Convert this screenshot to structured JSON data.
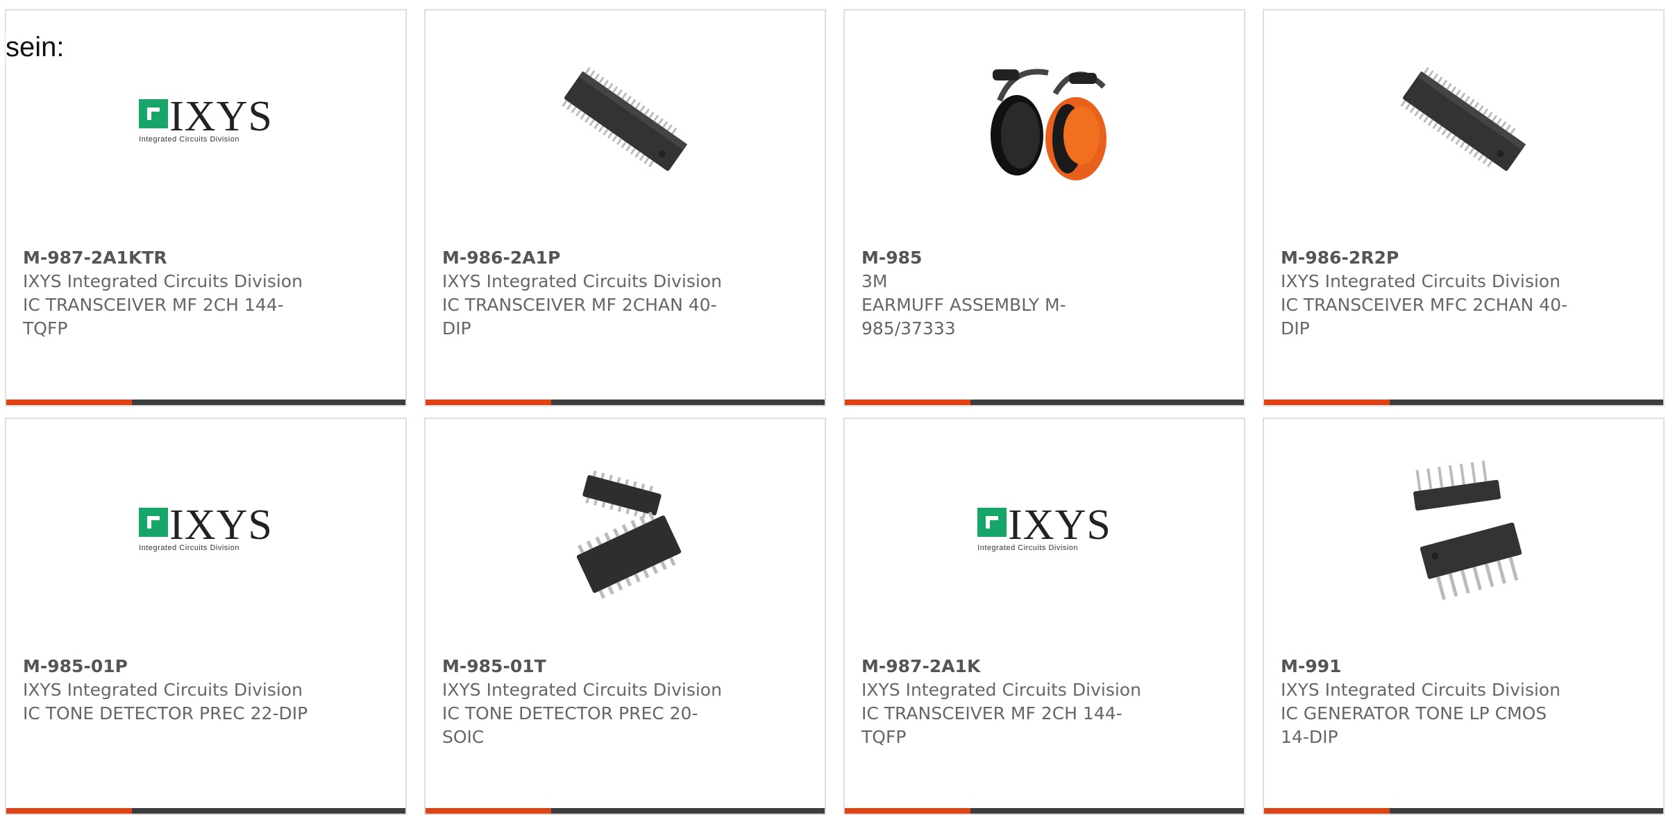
{
  "intro_text": "sein:",
  "products": [
    {
      "part": "M-987-2A1KTR",
      "manufacturer": "IXYS Integrated Circuits Division",
      "description": "IC TRANSCEIVER MF 2CH 144-TQFP",
      "image": "ixys-logo"
    },
    {
      "part": "M-986-2A1P",
      "manufacturer": "IXYS Integrated Circuits Division",
      "description": "IC TRANSCEIVER MF 2CHAN 40-DIP",
      "image": "dip-40-chip"
    },
    {
      "part": "M-985",
      "manufacturer": "3M",
      "description": "EARMUFF ASSEMBLY M-985/37333",
      "image": "earmuff"
    },
    {
      "part": "M-986-2R2P",
      "manufacturer": "IXYS Integrated Circuits Division",
      "description": "IC TRANSCEIVER MFC 2CHAN 40-DIP",
      "image": "dip-40-chip"
    },
    {
      "part": "M-985-01P",
      "manufacturer": "IXYS Integrated Circuits Division",
      "description": "IC TONE DETECTOR PREC 22-DIP",
      "image": "ixys-logo"
    },
    {
      "part": "M-985-01T",
      "manufacturer": "IXYS Integrated Circuits Division",
      "description": "IC TONE DETECTOR PREC 20-SOIC",
      "image": "soic-chips"
    },
    {
      "part": "M-987-2A1K",
      "manufacturer": "IXYS Integrated Circuits Division",
      "description": "IC TRANSCEIVER MF 2CH 144-TQFP",
      "image": "ixys-logo"
    },
    {
      "part": "M-991",
      "manufacturer": "IXYS Integrated Circuits Division",
      "description": "IC GENERATOR TONE LP CMOS 14-DIP",
      "image": "dip-14-chips"
    }
  ],
  "logo": {
    "name": "IXYS",
    "tagline": "Integrated Circuits Division"
  },
  "colors": {
    "accent": "#e04214",
    "bar": "#3d3d3d",
    "logo_green": "#17a56a"
  }
}
